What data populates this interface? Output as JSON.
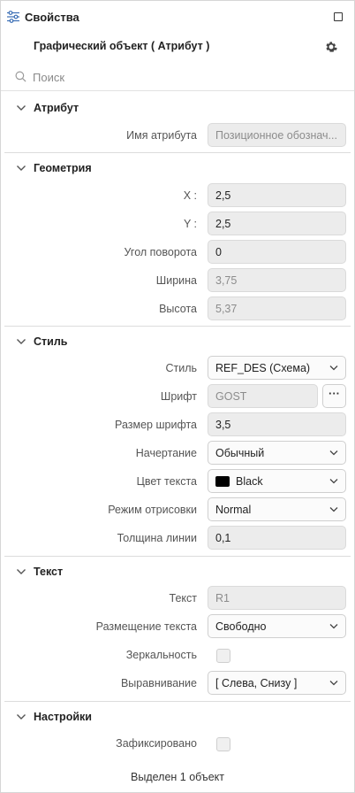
{
  "header": {
    "title": "Свойства"
  },
  "object": {
    "title": "Графический объект ( Атрибут )"
  },
  "search": {
    "placeholder": "Поиск"
  },
  "sections": {
    "attribute": {
      "title": "Атрибут",
      "name_label": "Имя атрибута",
      "name_value": "Позиционное обознач..."
    },
    "geometry": {
      "title": "Геометрия",
      "x_label": "X :",
      "x_value": "2,5",
      "y_label": "Y :",
      "y_value": "2,5",
      "angle_label": "Угол поворота",
      "angle_value": "0",
      "width_label": "Ширина",
      "width_value": "3,75",
      "height_label": "Высота",
      "height_value": "5,37"
    },
    "style": {
      "title": "Стиль",
      "style_label": "Стиль",
      "style_value": "REF_DES (Схема)",
      "font_label": "Шрифт",
      "font_value": "GOST",
      "font_size_label": "Размер шрифта",
      "font_size_value": "3,5",
      "typeface_label": "Начертание",
      "typeface_value": "Обычный",
      "color_label": "Цвет текста",
      "color_value": "Black",
      "color_hex": "#000000",
      "render_label": "Режим отрисовки",
      "render_value": "Normal",
      "line_label": "Толщина линии",
      "line_value": "0,1"
    },
    "text": {
      "title": "Текст",
      "text_label": "Текст",
      "text_value": "R1",
      "placement_label": "Размещение текста",
      "placement_value": "Свободно",
      "mirror_label": "Зеркальность",
      "mirror_checked": false,
      "align_label": "Выравнивание",
      "align_value": "[ Слева, Снизу ]"
    },
    "settings": {
      "title": "Настройки",
      "fixed_label": "Зафиксировано",
      "fixed_checked": false
    }
  },
  "status": {
    "text": "Выделен 1 объект"
  }
}
